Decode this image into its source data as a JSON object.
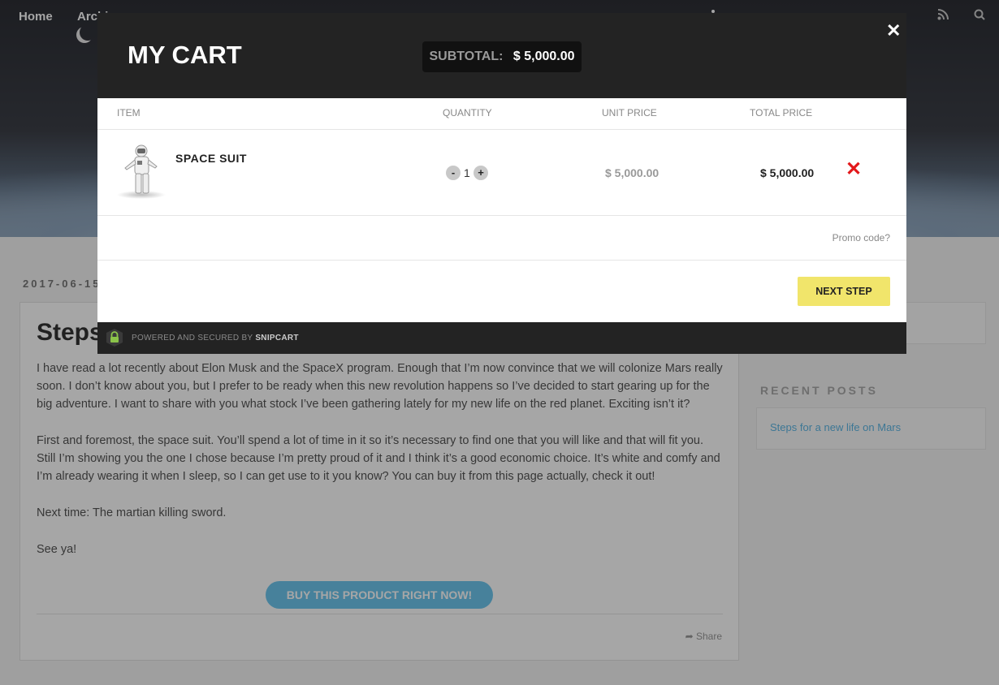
{
  "background": {
    "nav": [
      "Home",
      "Archives"
    ],
    "post": {
      "date": "2017-06-15",
      "title": "Steps for a new life on Mars",
      "paragraphs": [
        "I have read a lot recently about Elon Musk and the SpaceX program. Enough that I’m now convince that we will colonize Mars really soon. I don’t know about you, but I prefer to be ready when this new revolution happens so I’ve decided to start gearing up for the big adventure. I want to share with you what stock I’ve been gathering lately for my new life on the red planet. Exciting isn’t it?",
        "First and foremost, the space suit. You’ll spend a lot of time in it so it’s necessary to find one that you will like and that will fit you. Still I’m showing you the one I chose because I’m pretty proud of it and I think it’s a good economic choice. It’s white and comfy and I’m already wearing it when I sleep, so I can get use to it you know? You can buy it from this page actually, check it out!",
        "Next time: The martian killing sword.",
        "See ya!"
      ],
      "buy_button": "BUY THIS PRODUCT RIGHT NOW!",
      "share": "Share"
    },
    "sidebar": {
      "recent_heading": "RECENT POSTS",
      "recent_links": [
        "Steps for a new life on Mars"
      ]
    }
  },
  "cart": {
    "title": "MY CART",
    "subtotal_label": "SUBTOTAL:",
    "subtotal_value": "$ 5,000.00",
    "columns": {
      "item": "ITEM",
      "quantity": "QUANTITY",
      "unit_price": "UNIT PRICE",
      "total_price": "TOTAL PRICE"
    },
    "items": [
      {
        "name": "SPACE SUIT",
        "quantity": "1",
        "unit_price": "$ 5,000.00",
        "total_price": "$ 5,000.00"
      }
    ],
    "promo": "Promo code?",
    "next_button": "NEXT STEP",
    "footer_powered": "POWERED AND SECURED BY",
    "footer_brand": "SNIPCART"
  },
  "colors": {
    "accent_button": "#f1e56b",
    "remove": "#e3181b",
    "header": "#232323"
  }
}
